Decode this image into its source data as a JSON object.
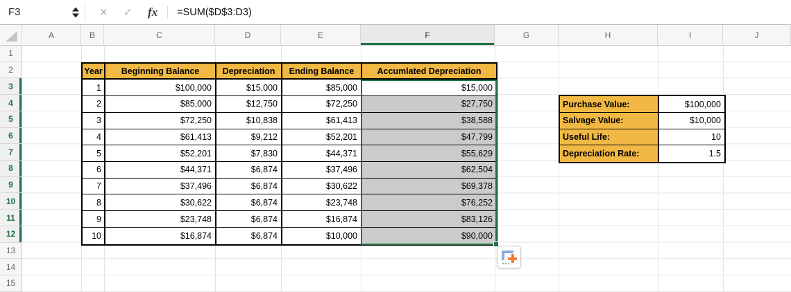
{
  "formula_bar": {
    "cell_reference": "F3",
    "cancel_glyph": "✕",
    "confirm_glyph": "✓",
    "fx_label": "fx",
    "formula": "=SUM($D$3:D3)"
  },
  "grid": {
    "columns": [
      "A",
      "B",
      "C",
      "D",
      "E",
      "F",
      "G",
      "H",
      "I",
      "J"
    ],
    "rows": [
      "1",
      "2",
      "3",
      "4",
      "5",
      "6",
      "7",
      "8",
      "9",
      "10",
      "11",
      "12",
      "13",
      "14",
      "15"
    ],
    "selection": {
      "active_cell": "F3",
      "selected_range": "F3:F12",
      "selected_column": "F",
      "selected_rows": "3-12"
    }
  },
  "depreciation_table": {
    "headers": [
      "Year",
      "Beginning Balance",
      "Depreciation",
      "Ending Balance",
      "Accumlated Depreciation"
    ],
    "rows": [
      [
        "1",
        "$100,000",
        "$15,000",
        "$85,000",
        "$15,000"
      ],
      [
        "2",
        "$85,000",
        "$12,750",
        "$72,250",
        "$27,750"
      ],
      [
        "3",
        "$72,250",
        "$10,838",
        "$61,413",
        "$38,588"
      ],
      [
        "4",
        "$61,413",
        "$9,212",
        "$52,201",
        "$47,799"
      ],
      [
        "5",
        "$52,201",
        "$7,830",
        "$44,371",
        "$55,629"
      ],
      [
        "6",
        "$44,371",
        "$6,874",
        "$37,496",
        "$62,504"
      ],
      [
        "7",
        "$37,496",
        "$6,874",
        "$30,622",
        "$69,378"
      ],
      [
        "8",
        "$30,622",
        "$6,874",
        "$23,748",
        "$76,252"
      ],
      [
        "9",
        "$23,748",
        "$6,874",
        "$16,874",
        "$83,126"
      ],
      [
        "10",
        "$16,874",
        "$6,874",
        "$10,000",
        "$90,000"
      ]
    ]
  },
  "inputs_table": {
    "rows": [
      {
        "label": "Purchase Value:",
        "value": "$100,000"
      },
      {
        "label": "Salvage Value:",
        "value": "$10,000"
      },
      {
        "label": "Useful Life:",
        "value": "10"
      },
      {
        "label": "Depreciation Rate:",
        "value": "1.5"
      }
    ]
  },
  "colors": {
    "header_fill": "#F1B843",
    "selection_green": "#217346",
    "selected_fill": "#CBCBCB"
  }
}
